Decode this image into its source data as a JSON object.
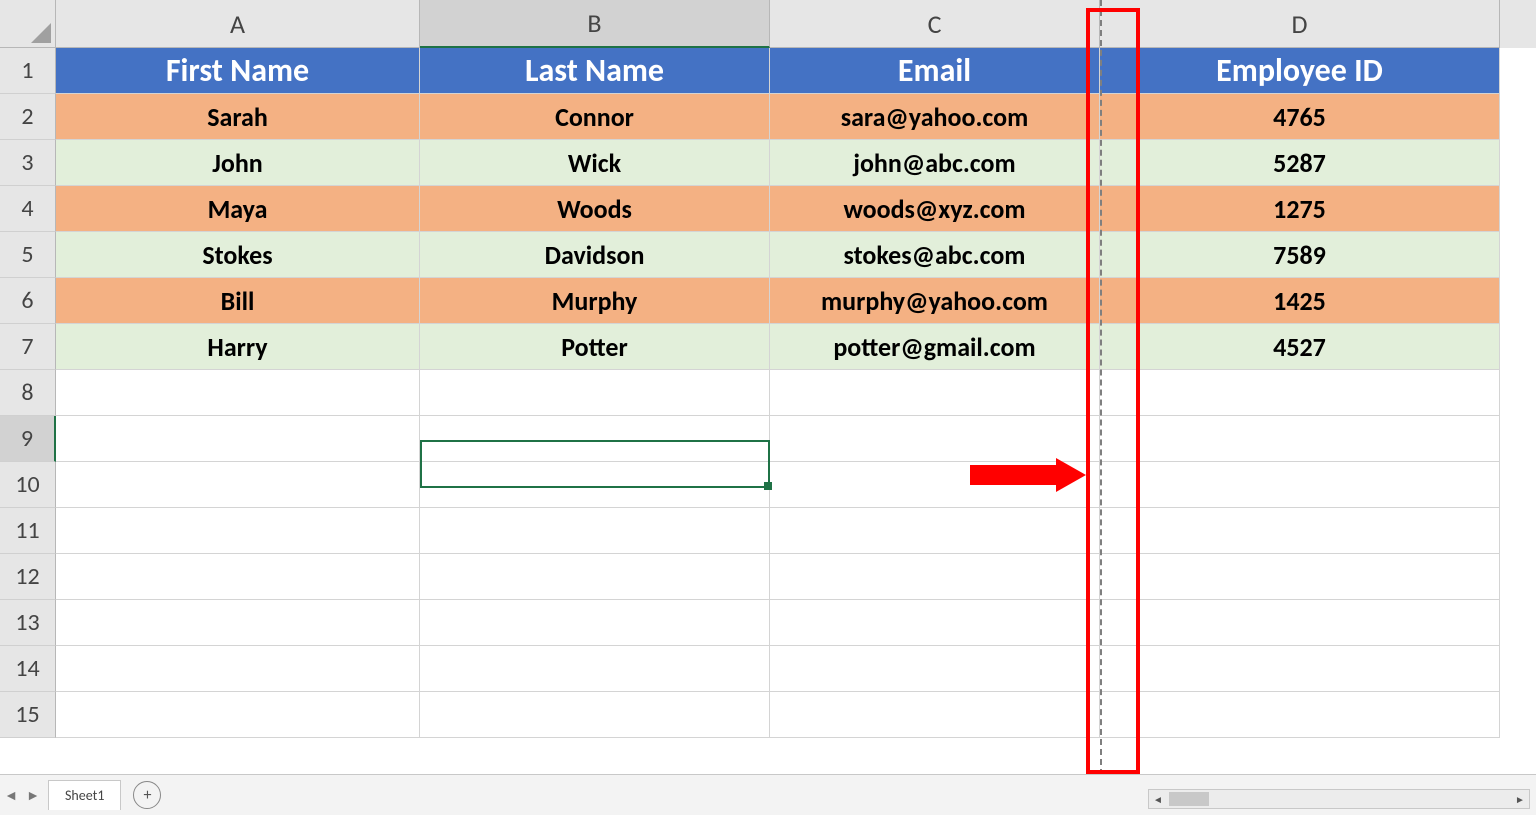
{
  "columns": [
    "A",
    "B",
    "C",
    "D"
  ],
  "headers": {
    "A": "First Name",
    "B": "Last Name",
    "C": "Email",
    "D": "Employee ID"
  },
  "rows": [
    {
      "first": "Sarah",
      "last": "Connor",
      "email": "sara@yahoo.com",
      "id": "4765"
    },
    {
      "first": "John",
      "last": "Wick",
      "email": "john@abc.com",
      "id": "5287"
    },
    {
      "first": "Maya",
      "last": "Woods",
      "email": "woods@xyz.com",
      "id": "1275"
    },
    {
      "first": "Stokes",
      "last": "Davidson",
      "email": "stokes@abc.com",
      "id": "7589"
    },
    {
      "first": "Bill",
      "last": "Murphy",
      "email": "murphy@yahoo.com",
      "id": "1425"
    },
    {
      "first": "Harry",
      "last": "Potter",
      "email": "potter@gmail.com",
      "id": "4527"
    }
  ],
  "row_numbers": [
    "1",
    "2",
    "3",
    "4",
    "5",
    "6",
    "7",
    "8",
    "9",
    "10",
    "11",
    "12",
    "13",
    "14",
    "15"
  ],
  "sheet_tab": "Sheet1",
  "selected_cell": "B9",
  "selected_col_header": "B",
  "selected_row_header": "9"
}
